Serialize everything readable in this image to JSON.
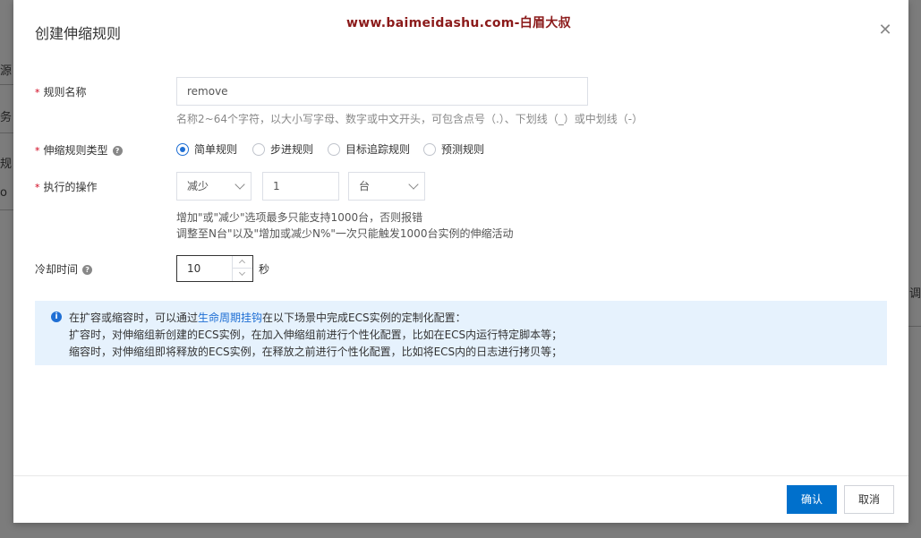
{
  "background": {
    "left_fragments": [
      "源",
      "务",
      "规",
      "o"
    ],
    "right_fragment": "调"
  },
  "modal": {
    "title": "创建伸缩规则",
    "watermark": "www.baimeidashu.com-白眉大叔",
    "close_icon": "close-icon"
  },
  "form": {
    "rule_name": {
      "label": "规则名称",
      "required_mark": "*",
      "value": "remove",
      "hint": "名称2~64个字符，以大小写字母、数字或中文开头，可包含点号（.）、下划线（_）或中划线（-）"
    },
    "rule_type": {
      "label": "伸缩规则类型",
      "required_mark": "*",
      "help_icon": "?",
      "options": [
        "简单规则",
        "步进规则",
        "目标追踪规则",
        "预测规则"
      ],
      "selected": "简单规则"
    },
    "action": {
      "label": "执行的操作",
      "required_mark": "*",
      "operation": "减少",
      "amount": "1",
      "unit": "台",
      "hint_line1": "增加\"或\"减少\"选项最多只能支持1000台，否则报错",
      "hint_line2": "调整至N台\"以及\"增加或减少N%\"一次只能触发1000台实例的伸缩活动"
    },
    "cooldown": {
      "label": "冷却时间",
      "help_icon": "?",
      "value": "10",
      "unit": "秒"
    }
  },
  "info": {
    "icon": "i",
    "line1_prefix": "在扩容或缩容时，可以通过",
    "link": "生命周期挂钩",
    "line1_suffix": "在以下场景中完成ECS实例的定制化配置：",
    "line2": "扩容时，对伸缩组新创建的ECS实例，在加入伸缩组前进行个性化配置，比如在ECS内运行特定脚本等；",
    "line3": "缩容时，对伸缩组即将释放的ECS实例，在释放之前进行个性化配置，比如将ECS内的日志进行拷贝等；"
  },
  "footer": {
    "confirm": "确认",
    "cancel": "取消"
  },
  "colors": {
    "primary": "#0070cc",
    "link": "#1f6fd4",
    "info_bg": "#e6f2fd",
    "required": "#d0021b",
    "watermark": "#8b1a1a"
  }
}
